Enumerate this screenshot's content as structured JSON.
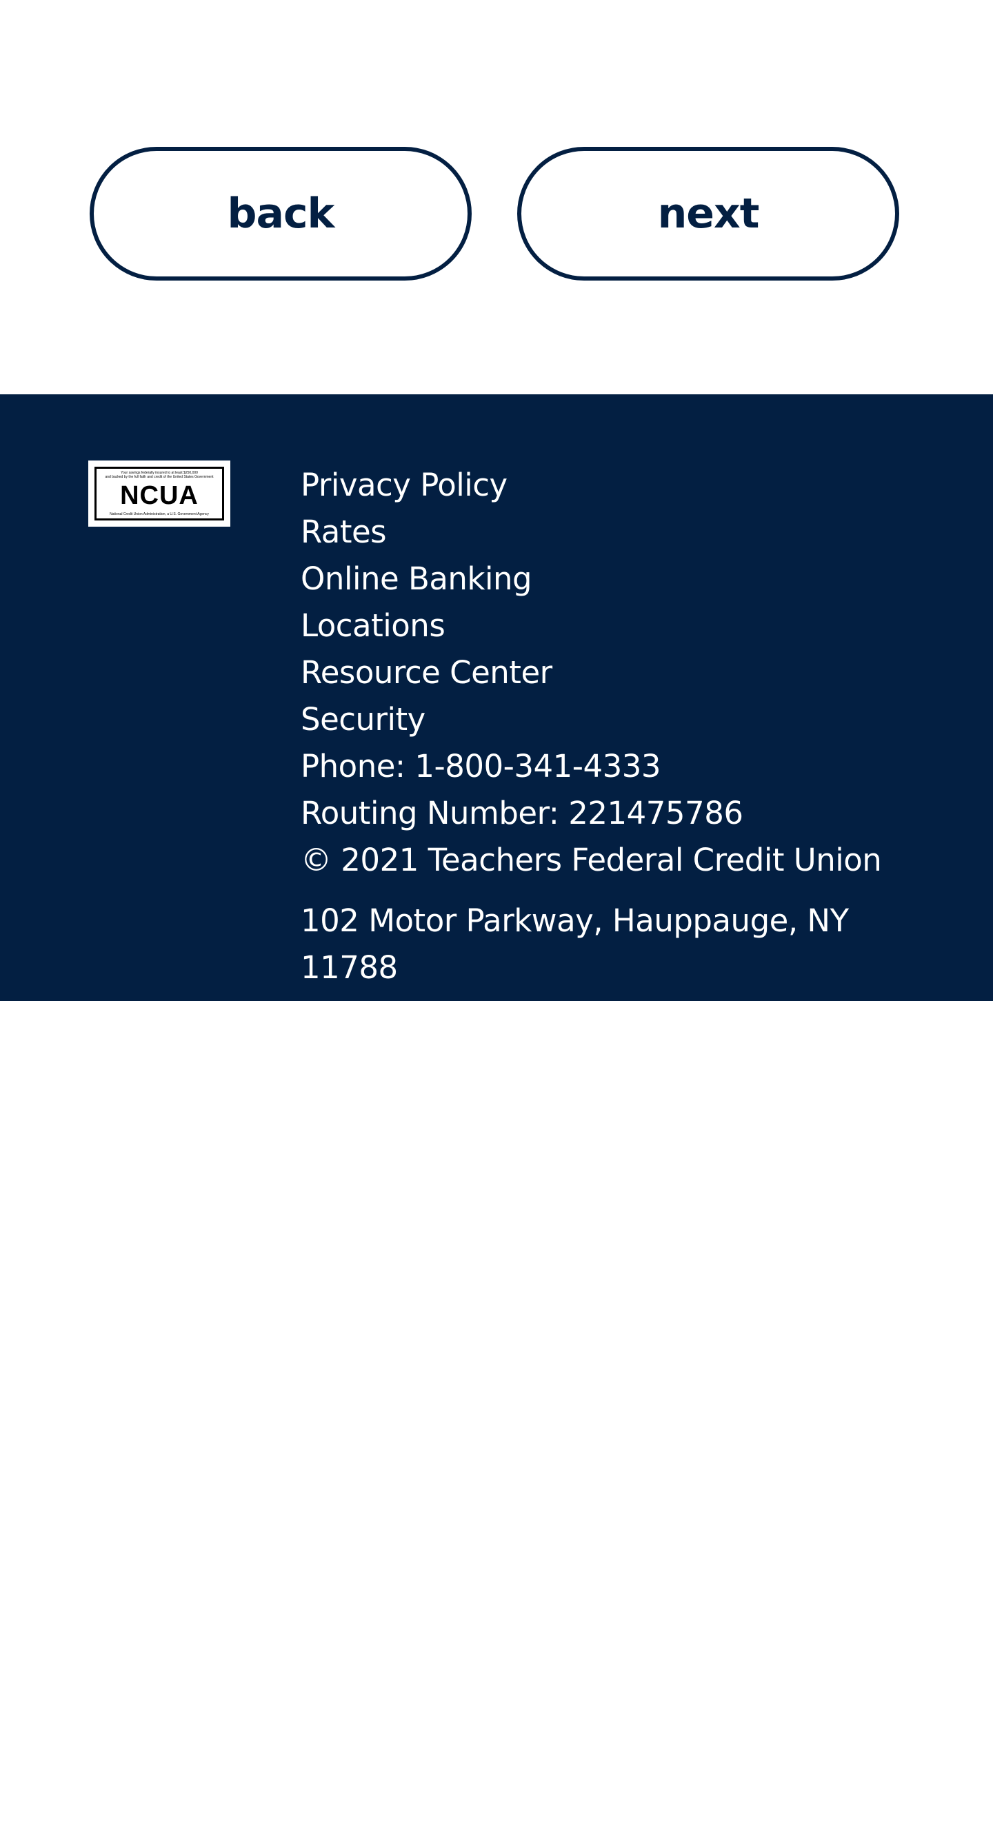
{
  "navigation": {
    "back_label": "back",
    "next_label": "next"
  },
  "footer": {
    "logo": {
      "name": "NCUA",
      "top_text": "Your savings federally insured to at least $250,000 and backed by the full faith and credit of the United States Government",
      "bottom_text": "National Credit Union Administration, a U.S. Government Agency"
    },
    "links": {
      "privacy_policy": "Privacy Policy",
      "rates": "Rates",
      "online_banking": "Online Banking",
      "locations": "Locations",
      "resource_center": "Resource Center",
      "security": "Security"
    },
    "phone": "Phone: 1-800-341-4333",
    "routing_number": "Routing Number: 221475786",
    "copyright": "© 2021 Teachers Federal Credit Union",
    "address": "102 Motor Parkway, Hauppauge, NY 11788"
  },
  "colors": {
    "navy": "#031f42",
    "white": "#ffffff"
  }
}
